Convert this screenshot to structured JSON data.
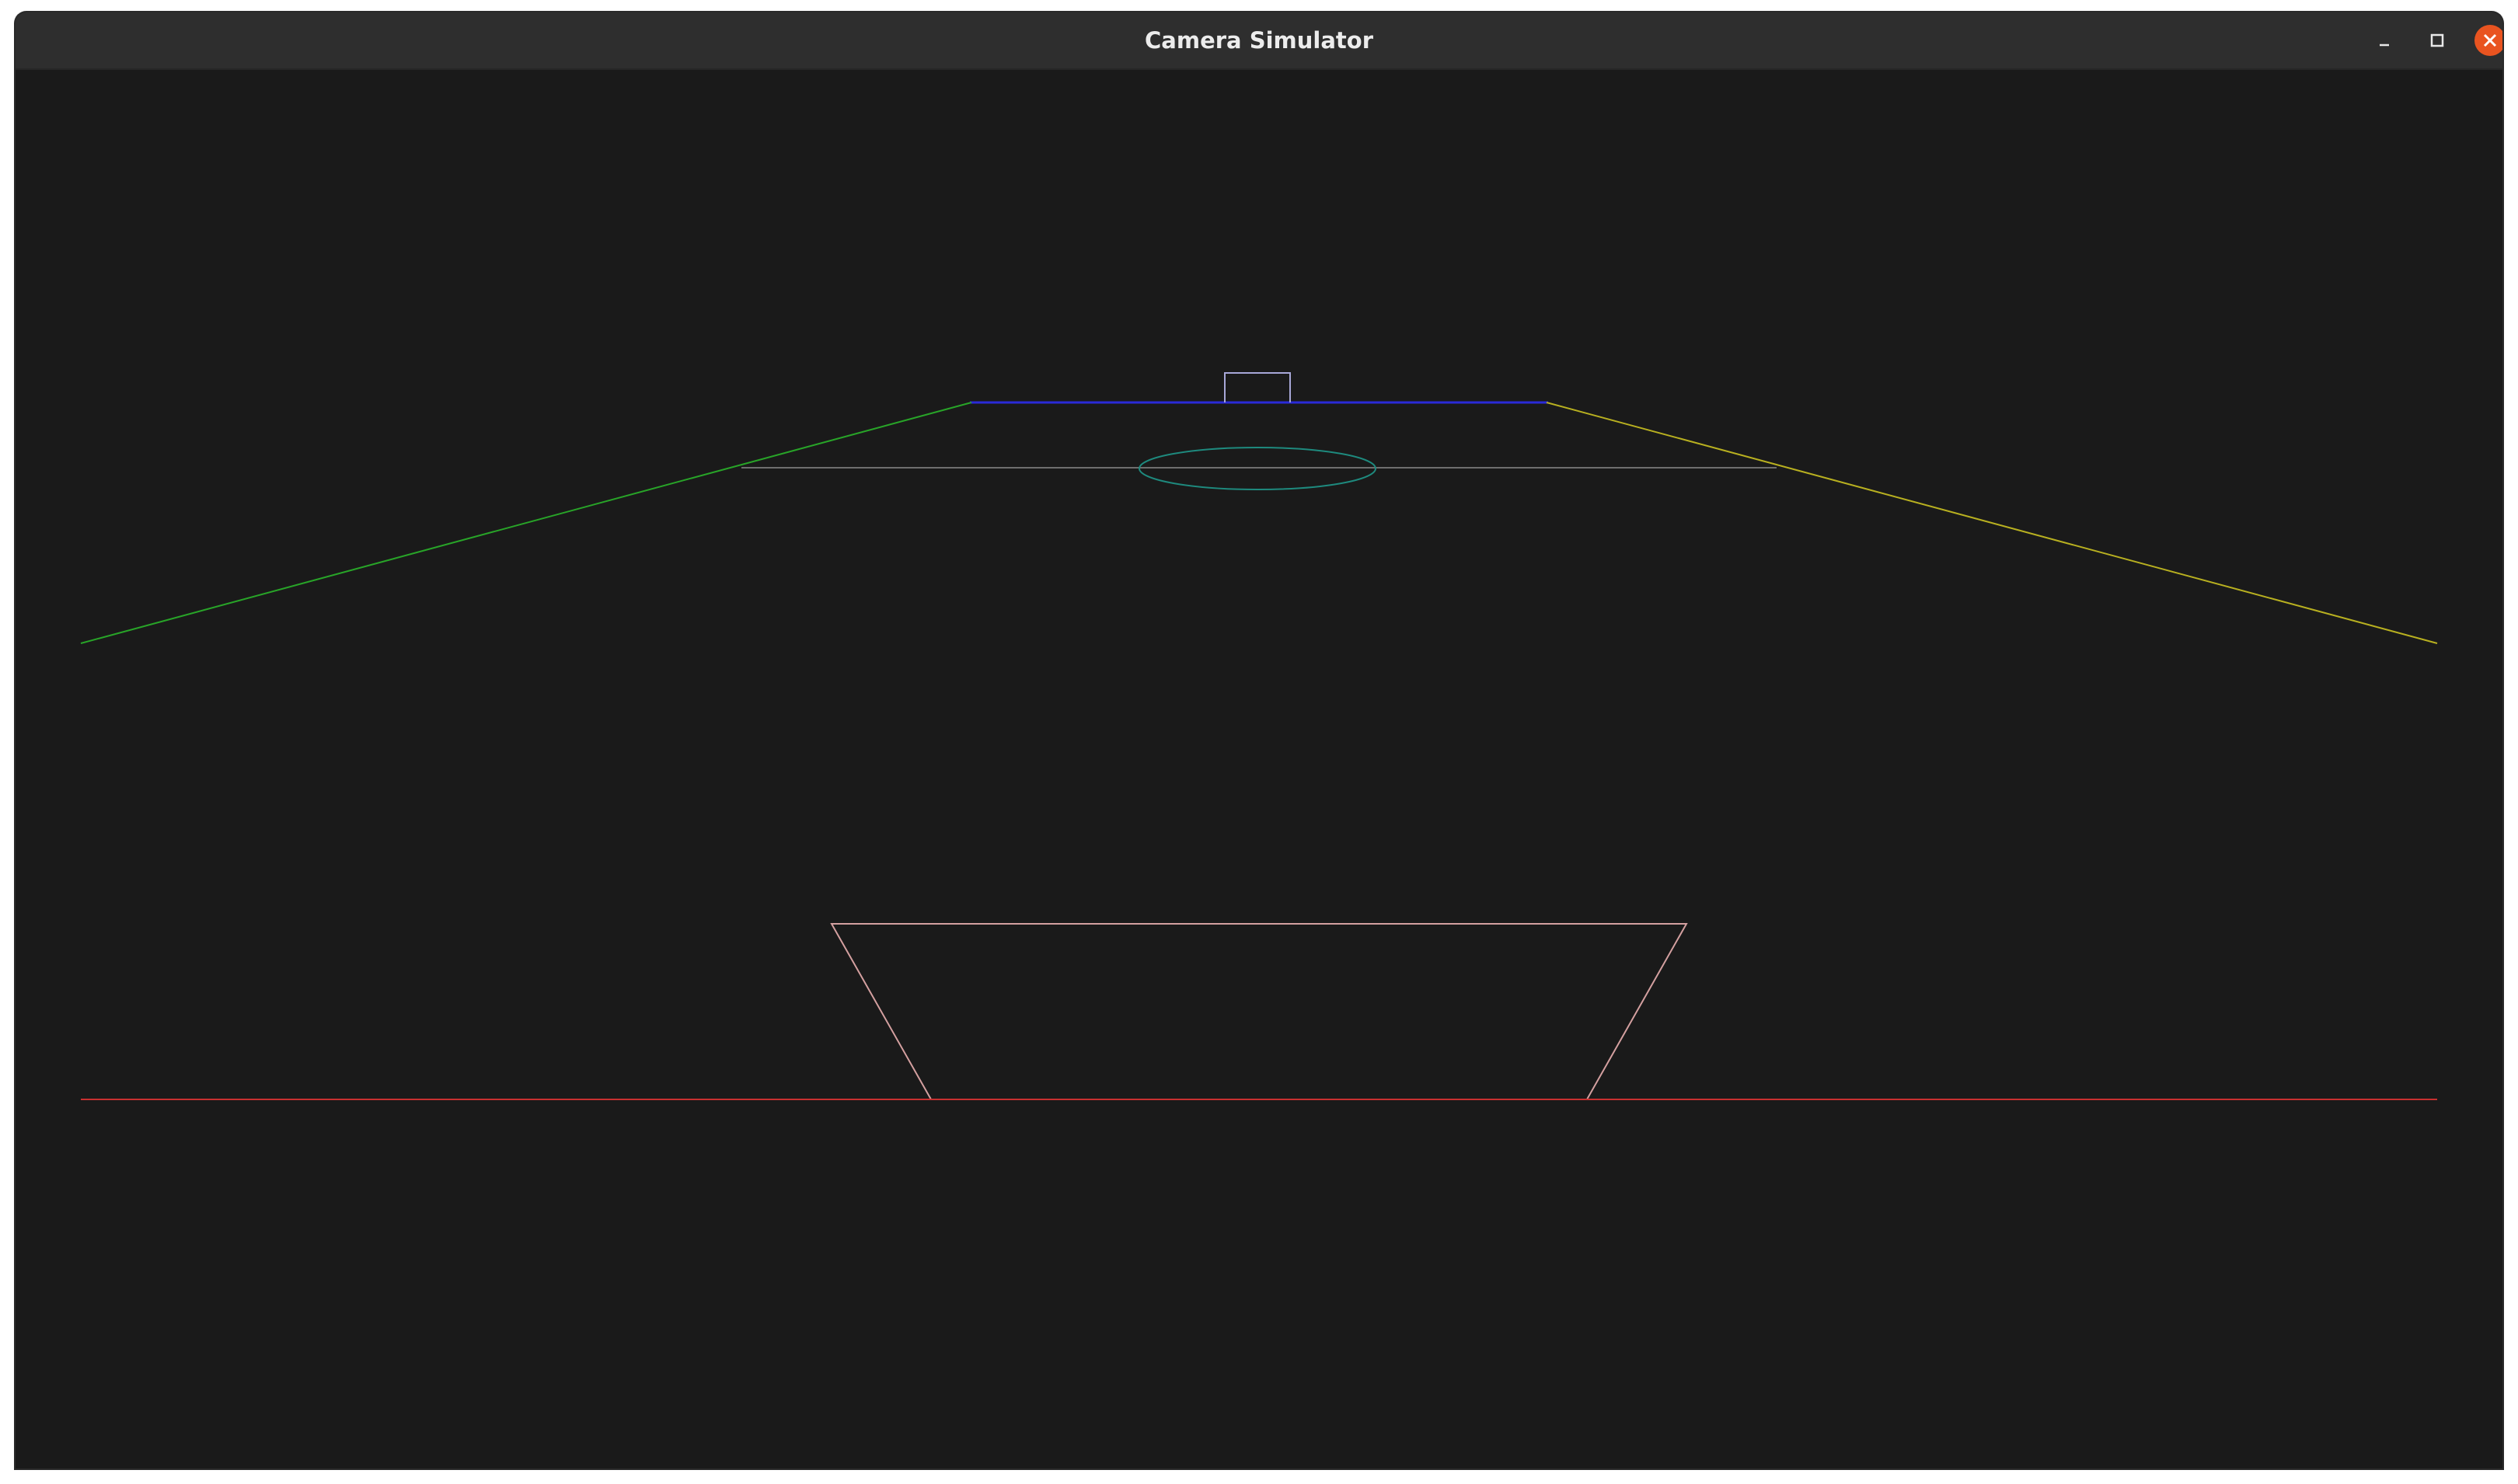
{
  "window": {
    "title": "Camera Simulator",
    "controls": {
      "minimize": "minimize-icon",
      "maximize": "maximize-icon",
      "close": "close-icon"
    }
  },
  "scene": {
    "background": "#1a1a1a",
    "colors": {
      "left_edge": "#28a428",
      "right_edge": "#b8b020",
      "far_edge": "#2a2ad8",
      "mid_line": "#6e6e6e",
      "ellipse": "#1e8a7e",
      "goal": "#a8a8d8",
      "near_box": "#d4a0a0",
      "baseline": "#c83030"
    }
  }
}
